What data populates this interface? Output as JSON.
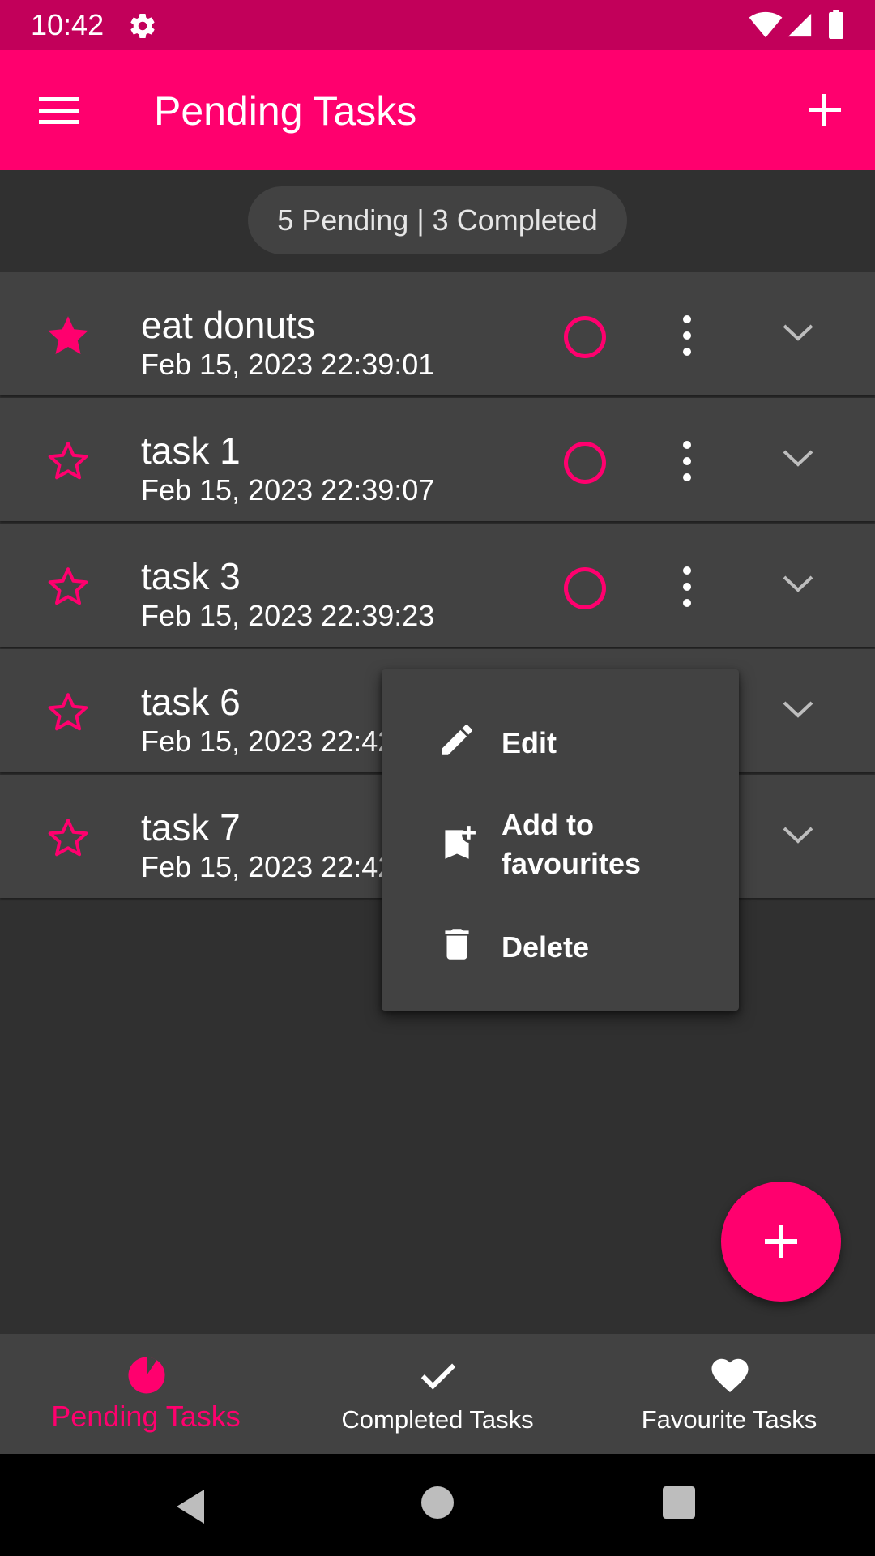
{
  "status_bar": {
    "time": "10:42",
    "icons": [
      "gear-icon",
      "wifi-icon",
      "signal-icon",
      "battery-icon"
    ]
  },
  "app_bar": {
    "title": "Pending Tasks",
    "menu_icon": "hamburger-menu-icon",
    "action_icon": "add-icon"
  },
  "summary": {
    "text": "5 Pending | 3 Completed"
  },
  "tasks": [
    {
      "title": "eat donuts",
      "date": "Feb 15, 2023 22:39:01",
      "favourite": true
    },
    {
      "title": "task 1",
      "date": "Feb 15, 2023 22:39:07",
      "favourite": false
    },
    {
      "title": "task 3",
      "date": "Feb 15, 2023 22:39:23",
      "favourite": false
    },
    {
      "title": "task 6",
      "date": "Feb 15, 2023 22:42",
      "favourite": false
    },
    {
      "title": "task 7",
      "date": "Feb 15, 2023 22:42",
      "favourite": false
    }
  ],
  "popup_menu": {
    "items": [
      {
        "label": "Edit",
        "icon": "pencil-icon"
      },
      {
        "label": "Add to favourites",
        "icon": "bookmark-add-icon"
      },
      {
        "label": "Delete",
        "icon": "trash-icon"
      }
    ]
  },
  "fab": {
    "icon": "add-icon"
  },
  "bottom_nav": {
    "tabs": [
      {
        "label": "Pending Tasks",
        "icon": "pie-clock-icon",
        "active": true
      },
      {
        "label": "Completed Tasks",
        "icon": "checkmark-icon",
        "active": false
      },
      {
        "label": "Favourite Tasks",
        "icon": "heart-icon",
        "active": false
      }
    ]
  },
  "colors": {
    "accent": "#FF006E",
    "status_bar": "#C2005A",
    "background": "#303030",
    "surface": "#424242"
  }
}
